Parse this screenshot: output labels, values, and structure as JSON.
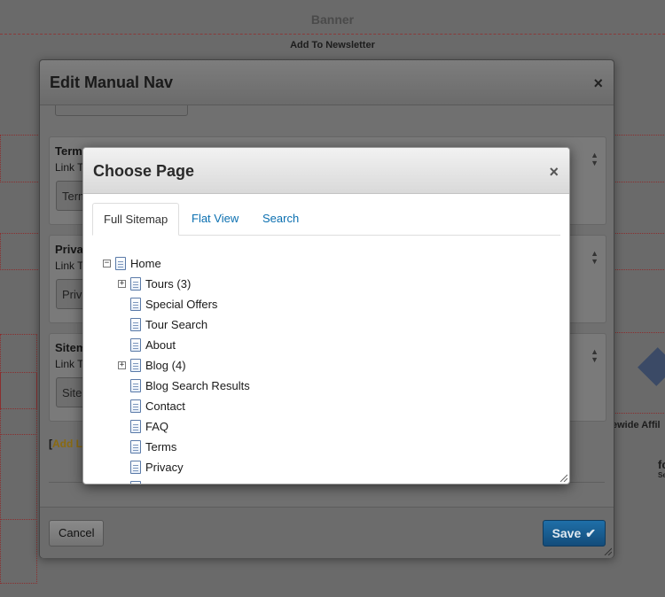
{
  "background": {
    "banner": "Banner",
    "newsletter": "Add To Newsletter",
    "affiliate_text": "ewide Affil",
    "side_text_1": "fo",
    "side_text_2": "Se"
  },
  "outer_modal": {
    "title": "Edit Manual Nav",
    "close_glyph": "×",
    "cards": [
      {
        "title": "Term",
        "sub": "Link T",
        "input": "Term"
      },
      {
        "title": "Priva",
        "sub": "Link T",
        "input": "Priv"
      },
      {
        "title": "Sitem",
        "sub": "Link T",
        "input": "Site"
      }
    ],
    "add_link_prefix": "[",
    "add_link_text": "Add L",
    "cancel_label": "Cancel",
    "save_label": "Save",
    "save_icon": "✔"
  },
  "inner_modal": {
    "title": "Choose Page",
    "close_glyph": "×",
    "tabs": [
      {
        "label": "Full Sitemap",
        "active": true
      },
      {
        "label": "Flat View",
        "active": false
      },
      {
        "label": "Search",
        "active": false
      }
    ],
    "tree": [
      {
        "label": "Home",
        "level": 0,
        "expander": "−"
      },
      {
        "label": "Tours (3)",
        "level": 1,
        "expander": "+"
      },
      {
        "label": "Special Offers",
        "level": 1,
        "expander": ""
      },
      {
        "label": "Tour Search",
        "level": 1,
        "expander": ""
      },
      {
        "label": "About",
        "level": 1,
        "expander": ""
      },
      {
        "label": "Blog (4)",
        "level": 1,
        "expander": "+"
      },
      {
        "label": "Blog Search Results",
        "level": 1,
        "expander": ""
      },
      {
        "label": "Contact",
        "level": 1,
        "expander": ""
      },
      {
        "label": "FAQ",
        "level": 1,
        "expander": ""
      },
      {
        "label": "Terms",
        "level": 1,
        "expander": ""
      },
      {
        "label": "Privacy",
        "level": 1,
        "expander": ""
      }
    ]
  }
}
